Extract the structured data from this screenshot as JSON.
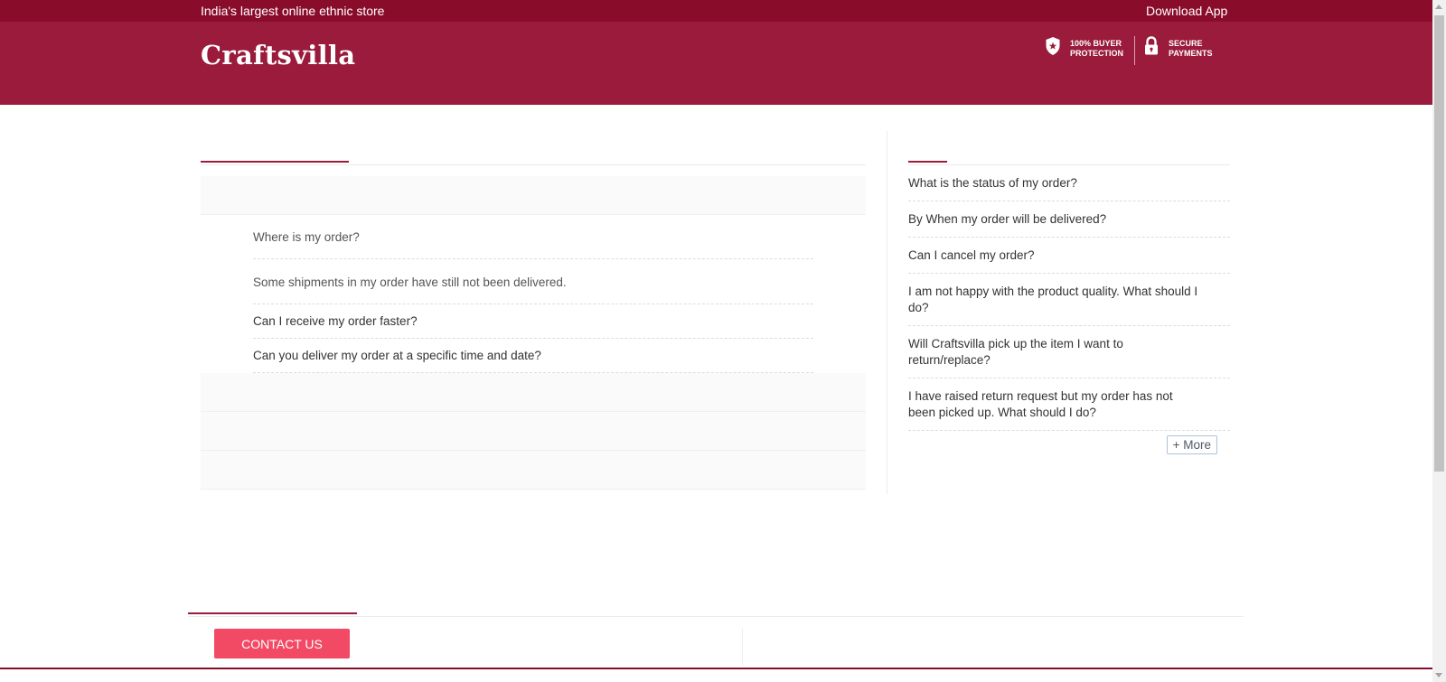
{
  "top_strip": {
    "tagline": "India's largest online ethnic store",
    "download_app": "Download App",
    "color": "#8a0c2b"
  },
  "header": {
    "logo": "Craftsvilla",
    "color": "#9a1b3b",
    "badges": [
      {
        "icon": "shield-star-icon",
        "line1": "100% BUYER",
        "line2": "PROTECTION"
      },
      {
        "icon": "padlock-icon",
        "line1": "SECURE",
        "line2": "PAYMENTS"
      }
    ]
  },
  "faq": {
    "questions": [
      "Where is my order?",
      "Some shipments in my order have still not been delivered.",
      "Can I receive my order faster?",
      "Can you deliver my order at a specific time and date?"
    ]
  },
  "popular": {
    "questions": [
      "What is the status of my order?",
      "By When my order will be delivered?",
      "Can I cancel my order?",
      "I am not happy with the product quality. What should I do?",
      "Will Craftsvilla pick up the item I want to return/replace?",
      "I have raised return request but my order has not been picked up. What should I do?"
    ],
    "more_label": "+ More"
  },
  "footer": {
    "contact_label": "CONTACT US",
    "contact_color": "#f24a64"
  }
}
